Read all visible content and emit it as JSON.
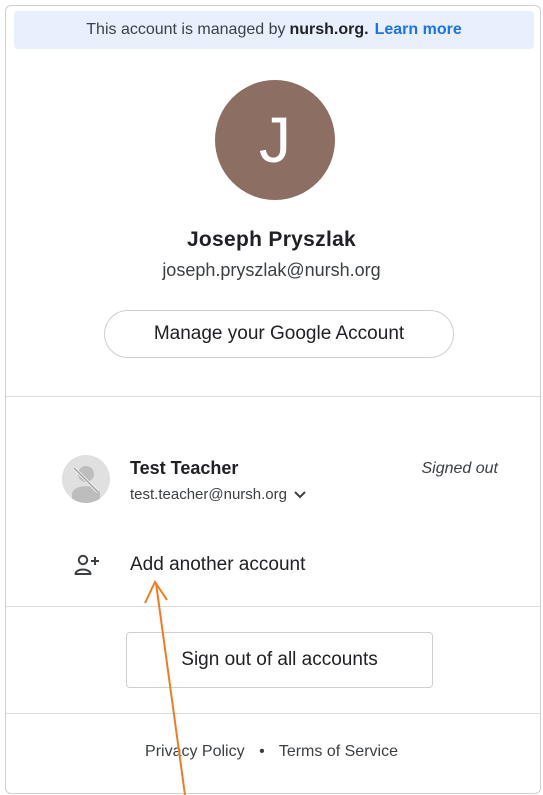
{
  "banner": {
    "prefix": "This account is managed by",
    "domain": "nursh.org.",
    "learn_more": "Learn more"
  },
  "profile": {
    "initial": "J",
    "avatar_color": "#8d6e63",
    "name": "Joseph Pryszlak",
    "email": "joseph.pryszlak@nursh.org"
  },
  "manage_button": "Manage your Google Account",
  "other_account": {
    "name": "Test Teacher",
    "email": "test.teacher@nursh.org",
    "status": "Signed out",
    "avatar_icon": "signed-out-person-icon",
    "dropdown_icon": "chevron-down-icon"
  },
  "add_account": {
    "label": "Add another account",
    "icon": "add-person-icon"
  },
  "sign_out_button": "Sign out of all accounts",
  "footer": {
    "privacy": "Privacy Policy",
    "separator": "•",
    "terms": "Terms of Service"
  },
  "annotation": {
    "color": "#f07c1e"
  }
}
